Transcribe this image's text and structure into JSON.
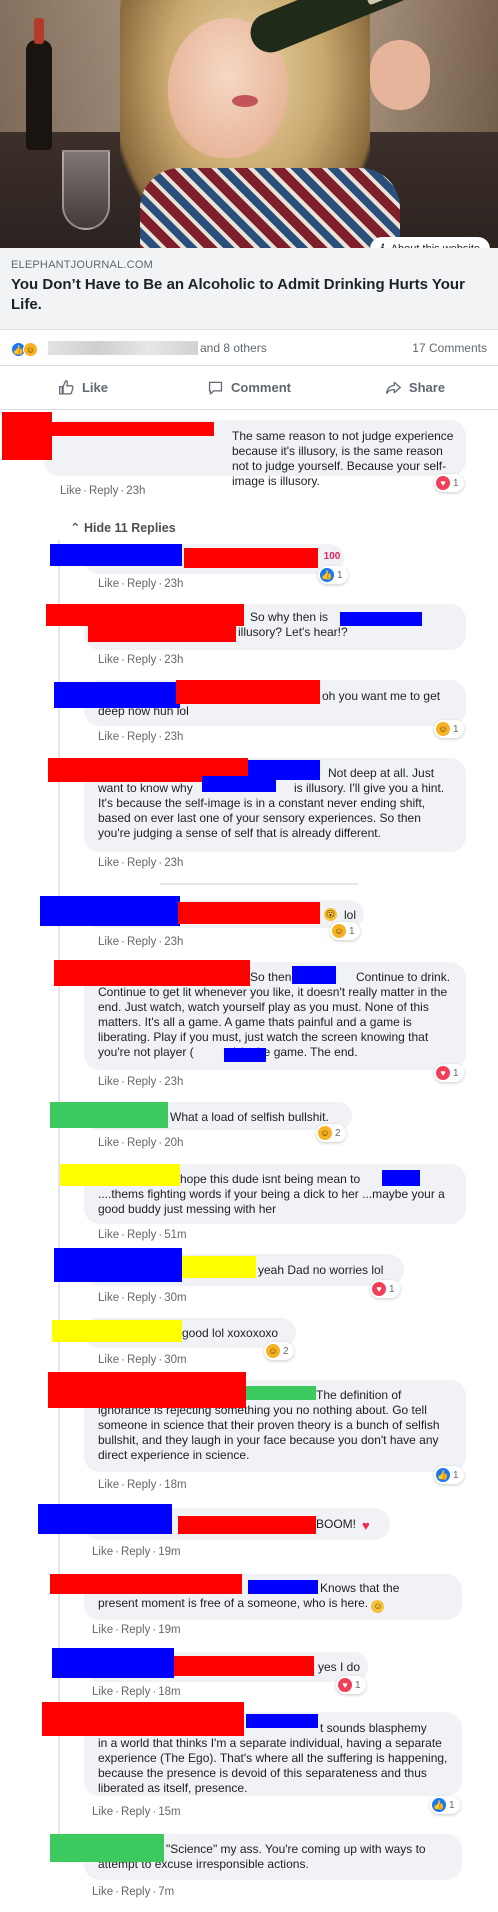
{
  "link_preview": {
    "about_label": "About this website",
    "domain": "ELEPHANTJOURNAL.COM",
    "title": "You Don’t Have to Be an Alcoholic to Admit Drinking Hurts Your Life."
  },
  "reactions": {
    "others_text": "and 8 others",
    "comments_count": "17 Comments"
  },
  "actions": {
    "like": "Like",
    "comment": "Comment",
    "share": "Share"
  },
  "meta_labels": {
    "like": "Like",
    "reply": "Reply",
    "dot": "·"
  },
  "hide_replies": "Hide 11 Replies",
  "comments": [
    {
      "text": "The same reason to not judge experience because it's illusory, is the same reason not to judge yourself. Because your self-image is illusory.",
      "time": "23h",
      "badge_count": "1",
      "badge_type": "heart"
    },
    {
      "text": "",
      "time": "23h",
      "badge_count": "1",
      "badge_type": "like",
      "emoji": "100"
    },
    {
      "text": "So why then is",
      "text2": "illusory? Let's hear!?",
      "time": "23h"
    },
    {
      "text": "oh you want me to get",
      "text2": "deep now huh lol",
      "time": "23h",
      "badge_count": "1",
      "badge_type": "haha"
    },
    {
      "text": "Not deep at all. Just",
      "text2": "want to know why",
      "text3": "is illusory. I'll give you a hint. It's because the self-image is in a constant never ending shift, based on ever last one of your sensory experiences. So then you're judging a sense of self that is already different.",
      "time": "23h"
    },
    {
      "text": "lol",
      "time": "23h",
      "badge_count": "1",
      "badge_type": "haha"
    },
    {
      "text": "So then",
      "text2": "Continue to drink. Continue to get lit whenever you like, it doesn't really matter in the end. Just watch, watch yourself play as you must. None of this matters. It's all a game. A game thats painful and a game is liberating. Play if you must, just watch the screen knowing that you're not player (",
      "text3": ") in the game. The end.",
      "time": "23h",
      "badge_count": "1",
      "badge_type": "heart"
    },
    {
      "text": "What a load of selfish bullshit.",
      "time": "20h",
      "badge_count": "2",
      "badge_type": "haha"
    },
    {
      "text": "hope this dude isnt being mean to",
      "text2": "....thems fighting words if your being a dick to her ...maybe your a good buddy just messing with her",
      "time": "51m"
    },
    {
      "text": "yeah Dad no worries lol",
      "time": "30m",
      "badge_count": "1",
      "badge_type": "heart"
    },
    {
      "text": "good lol xoxoxoxo",
      "time": "30m",
      "badge_count": "2",
      "badge_type": "haha"
    },
    {
      "text": "The definition of",
      "text2": "ignorance is rejecting something you no nothing about. Go tell someone in science that their proven theory is a bunch of selfish bullshit, and they laugh in your face because you don't have any direct experience in science.",
      "time": "18m",
      "badge_count": "1",
      "badge_type": "like"
    },
    {
      "text": "BOOM!",
      "time": "19m"
    },
    {
      "text": "Knows that the",
      "text2": "present moment is free of a someone, who is here.",
      "time": "19m"
    },
    {
      "text": "yes I do",
      "time": "18m",
      "badge_count": "1",
      "badge_type": "heart"
    },
    {
      "text": "t sounds blasphemy",
      "text2": "in a world that thinks I'm a separate individual, having a separate experience (The Ego). That's where all the suffering is happening, because the presence is devoid of this separateness and thus liberated as itself, presence.",
      "time": "15m",
      "badge_count": "1",
      "badge_type": "like"
    },
    {
      "text": "\"Science\" my ass. You're coming up with ways to",
      "text2": "attempt to excuse irresponsible actions.",
      "time": "7m"
    }
  ],
  "colors": {
    "like_blue": "#1877f2",
    "heart_red": "#f33e58",
    "haha_yellow": "#f7b125",
    "bubble_gray": "#f0f2f5",
    "meta_gray": "#65676b"
  }
}
